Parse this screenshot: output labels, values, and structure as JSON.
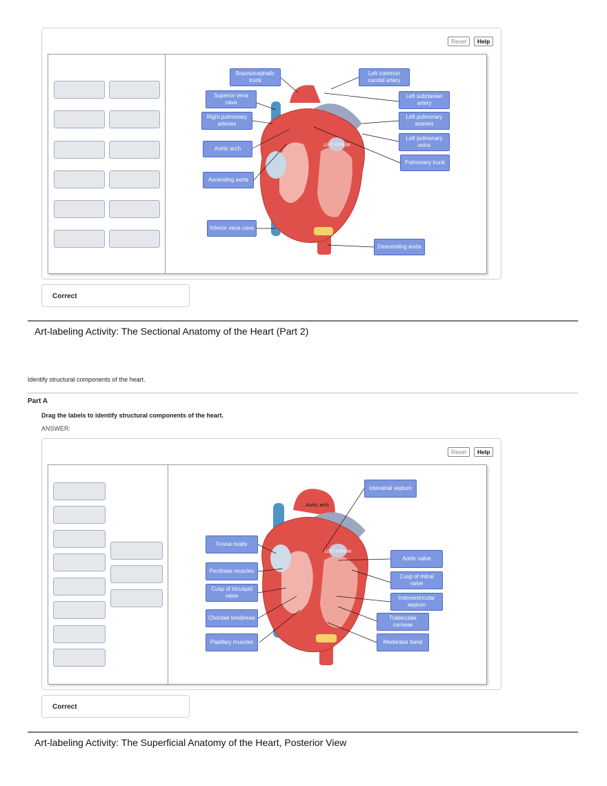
{
  "activity1": {
    "buttons": {
      "reset": "Reset",
      "help": "Help"
    },
    "labels": [
      "Brachiocephalic trunk",
      "Left common carotid artery",
      "Superior vena cava",
      "Left subclavian artery",
      "Right pulmonary arteries",
      "Left pulmonary arteries",
      "Left pulmonary veins",
      "Aortic arch",
      "Pulmonary trunk",
      "Ascending aorta",
      "Inferior vena cava",
      "Descending aorta"
    ],
    "diagram_text": "LEFT ATRIUM",
    "feedback": "Correct"
  },
  "section2": {
    "title": "Art-labeling Activity: The Sectional Anatomy of the Heart (Part 2)",
    "intro": "Identify structural components of the heart.",
    "part": "Part A",
    "instruction": "Drag the labels to identify structural components of the heart.",
    "answer_label": "ANSWER:"
  },
  "activity2": {
    "buttons": {
      "reset": "Reset",
      "help": "Help"
    },
    "labels": [
      "Interatrial septum",
      "Fossa ovalis",
      "Aortic valve",
      "Pectinate muscles",
      "Cusp of mitral valve",
      "Cusp of tricuspid valve",
      "Interventricular septum",
      "Chordae tendineae",
      "Trabeculae carneae",
      "Papillary muscles",
      "Moderator band"
    ],
    "diagram_text": [
      "Aortic arch",
      "LEFT ATRIUM"
    ],
    "feedback": "Correct"
  },
  "section3": {
    "title": "Art-labeling Activity: The Superficial Anatomy of the Heart, Posterior View"
  },
  "colors": {
    "label_fill": "#7d98e0",
    "label_border": "#4b68c6",
    "slot_fill": "#e5e7ea",
    "heart_red": "#e0504a",
    "vessel_blue": "#4f95c4"
  }
}
